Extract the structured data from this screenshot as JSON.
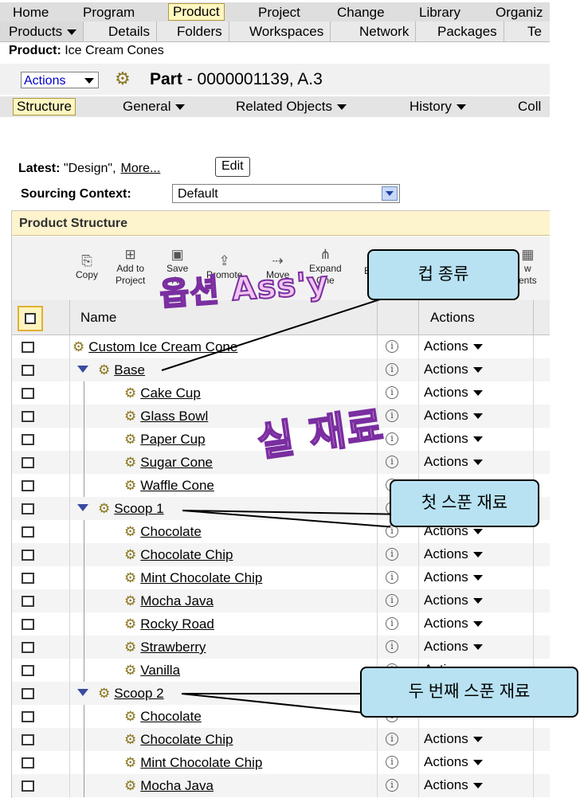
{
  "nav_main": {
    "items": [
      "Home",
      "Program",
      "Product",
      "Project",
      "Change",
      "Library",
      "Organiz"
    ],
    "selected": "Product"
  },
  "nav_sub": {
    "first": "Products",
    "items": [
      "Details",
      "Folders",
      "Workspaces",
      "Network",
      "Packages",
      "Te"
    ]
  },
  "breadcrumb": {
    "label": "Product:",
    "value": "Ice Cream Cones"
  },
  "header": {
    "actions_label": "Actions",
    "part_label": "Part",
    "part_number": "- 0000001139, A.3"
  },
  "tabs": {
    "items": [
      "Structure",
      "General",
      "Related Objects",
      "History",
      "Coll"
    ],
    "selected": "Structure"
  },
  "latest": {
    "label": "Latest:",
    "value": "\"Design\",",
    "more_link": "More...",
    "edit_button": "Edit"
  },
  "sourcing": {
    "label": "Sourcing Context:",
    "value": "Default"
  },
  "structure": {
    "title": "Product Structure",
    "toolbar": [
      {
        "label": "Copy",
        "icon": "copy-icon"
      },
      {
        "label": "Add to\nProject",
        "icon": "add-to-project-icon"
      },
      {
        "label": "Save\nAs",
        "icon": "save-as-icon"
      },
      {
        "label": "Promote",
        "icon": "promote-icon"
      },
      {
        "label": "Move",
        "icon": "move-icon"
      },
      {
        "label": "Expand\nOne",
        "icon": "expand-one-icon"
      },
      {
        "label": "E",
        "icon": ""
      },
      {
        "label": "w\nents",
        "icon": "new-icon"
      }
    ],
    "columns": {
      "name": "Name",
      "actions": "Actions"
    },
    "rows": [
      {
        "name": "Custom Ice Cream Cone",
        "level": 0,
        "expandable": false,
        "actions": "Actions"
      },
      {
        "name": "Base",
        "level": 1,
        "expandable": true,
        "actions": "Actions"
      },
      {
        "name": "Cake Cup",
        "level": 2,
        "expandable": false,
        "actions": "Actions"
      },
      {
        "name": "Glass Bowl",
        "level": 2,
        "expandable": false,
        "actions": "Actions"
      },
      {
        "name": "Paper Cup",
        "level": 2,
        "expandable": false,
        "actions": "Actions"
      },
      {
        "name": "Sugar Cone",
        "level": 2,
        "expandable": false,
        "actions": "Actions"
      },
      {
        "name": "Waffle Cone",
        "level": 2,
        "expandable": false,
        "actions": ""
      },
      {
        "name": "Scoop 1",
        "level": 1,
        "expandable": true,
        "actions": ""
      },
      {
        "name": "Chocolate",
        "level": 2,
        "expandable": false,
        "actions": "Actions"
      },
      {
        "name": "Chocolate Chip",
        "level": 2,
        "expandable": false,
        "actions": "Actions"
      },
      {
        "name": "Mint Chocolate Chip",
        "level": 2,
        "expandable": false,
        "actions": "Actions"
      },
      {
        "name": "Mocha Java",
        "level": 2,
        "expandable": false,
        "actions": "Actions"
      },
      {
        "name": "Rocky Road",
        "level": 2,
        "expandable": false,
        "actions": "Actions"
      },
      {
        "name": "Strawberry",
        "level": 2,
        "expandable": false,
        "actions": "Actions"
      },
      {
        "name": "Vanilla",
        "level": 2,
        "expandable": false,
        "actions": "Actions"
      },
      {
        "name": "Scoop 2",
        "level": 1,
        "expandable": true,
        "actions": ""
      },
      {
        "name": "Chocolate",
        "level": 2,
        "expandable": false,
        "actions": ""
      },
      {
        "name": "Chocolate Chip",
        "level": 2,
        "expandable": false,
        "actions": "Actions"
      },
      {
        "name": "Mint Chocolate Chip",
        "level": 2,
        "expandable": false,
        "actions": "Actions"
      },
      {
        "name": "Mocha Java",
        "level": 2,
        "expandable": false,
        "actions": "Actions"
      }
    ]
  },
  "annotations": {
    "callout_cup_type": "컵 종류",
    "callout_first_scoop": "첫 스푼 재료",
    "callout_second_scoop": "두 번째 스푼 재료",
    "watermark_option_assy": "옵션 Ass'y",
    "watermark_real_material": "실 재료"
  },
  "colors": {
    "selected_tab_bg": "#fff6c0",
    "panel_header_bg": "#fdf3cc",
    "callout_bg": "#b8e2f2",
    "link_blue": "#0000c8",
    "watermark_fill": "#f0c4f0",
    "watermark_stroke": "#7a2ea0"
  }
}
